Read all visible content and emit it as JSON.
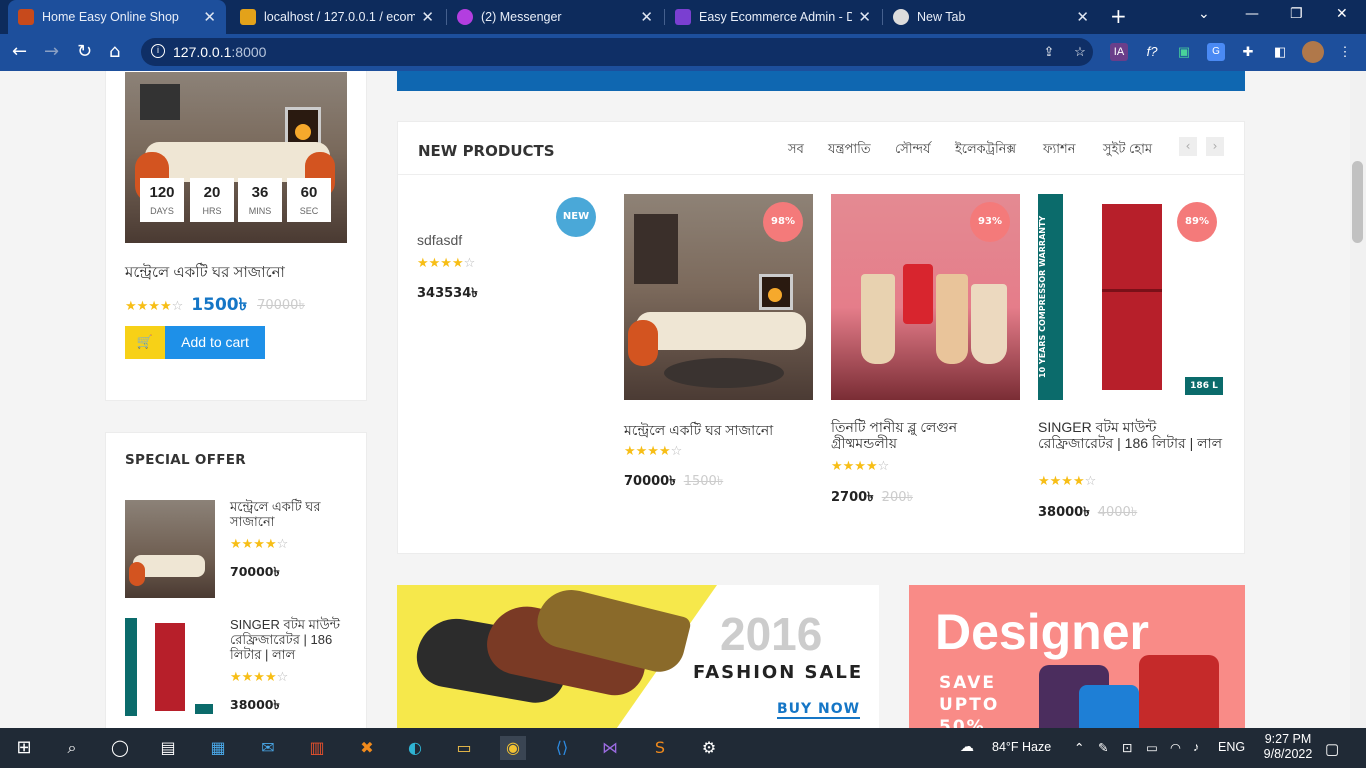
{
  "browser": {
    "tabs": [
      {
        "title": "Home Easy Online Shop",
        "fav": "#c74a1c"
      },
      {
        "title": "localhost / 127.0.0.1 / ecom /",
        "fav": "#e3a21a"
      },
      {
        "title": "(2) Messenger",
        "fav": "#b33ee0"
      },
      {
        "title": "Easy Ecommerce Admin - Da",
        "fav": "#7a3fd1"
      },
      {
        "title": "New Tab",
        "fav": "#dcdcdc"
      }
    ],
    "address": {
      "host": "127.0.0.1",
      "port": ":8000"
    }
  },
  "deal": {
    "countdown": [
      {
        "value": "120",
        "unit": "DAYS"
      },
      {
        "value": "20",
        "unit": "HRS"
      },
      {
        "value": "36",
        "unit": "MINS"
      },
      {
        "value": "60",
        "unit": "SEC"
      }
    ],
    "title": "মন্ট্রেলে একটি ঘর সাজানো",
    "rating": 4,
    "price": "1500৳",
    "old_price": "70000৳",
    "add_to_cart": "Add to cart"
  },
  "special_offer": {
    "heading": "SPECIAL OFFER",
    "items": [
      {
        "title": "মন্ট্রেলে একটি ঘর সাজানো",
        "rating": 4,
        "price": "70000৳"
      },
      {
        "title": "SINGER বটম মাউন্ট রেফ্রিজারেটর | 186 লিটার | লাল",
        "rating": 4,
        "price": "38000৳"
      }
    ]
  },
  "new_products": {
    "heading": "NEW PRODUCTS",
    "categories": [
      "সব",
      "যন্ত্রপাতি",
      "সৌন্দর্য",
      "ইলেকট্রনিক্স",
      "ফ্যাশন",
      "সুইট হোম"
    ],
    "items": [
      {
        "badge": "NEW",
        "title": "sdfasdf",
        "rating": 4,
        "price": "343534৳",
        "old_price": ""
      },
      {
        "badge": "98%",
        "title": "মন্ট্রেলে একটি ঘর সাজানো",
        "rating": 4,
        "price": "70000৳",
        "old_price": "1500৳"
      },
      {
        "badge": "93%",
        "title": "তিনটি পানীয় ব্লু লেগুন গ্রীষ্মমন্ডলীয়",
        "rating": 4,
        "price": "2700৳",
        "old_price": "200৳"
      },
      {
        "badge": "89%",
        "title": "SINGER বটম মাউন্ট রেফ্রিজারেটর | 186 লিটার | লাল",
        "rating": 4,
        "price": "38000৳",
        "old_price": "4000৳"
      }
    ]
  },
  "banners": {
    "fashion": {
      "year": "2016",
      "sale": "FASHION SALE",
      "cta": "BUY NOW"
    },
    "designer": {
      "title": "Designer",
      "save": "SAVE",
      "upto": "UPTO",
      "pct": "50%"
    }
  },
  "fridge_labels": {
    "warranty": "10 YEARS COMPRESSOR WARRANTY",
    "litre": "186 L"
  },
  "taskbar": {
    "weather": "84°F  Haze",
    "lang": "ENG",
    "time": "9:27 PM",
    "date": "9/8/2022"
  }
}
